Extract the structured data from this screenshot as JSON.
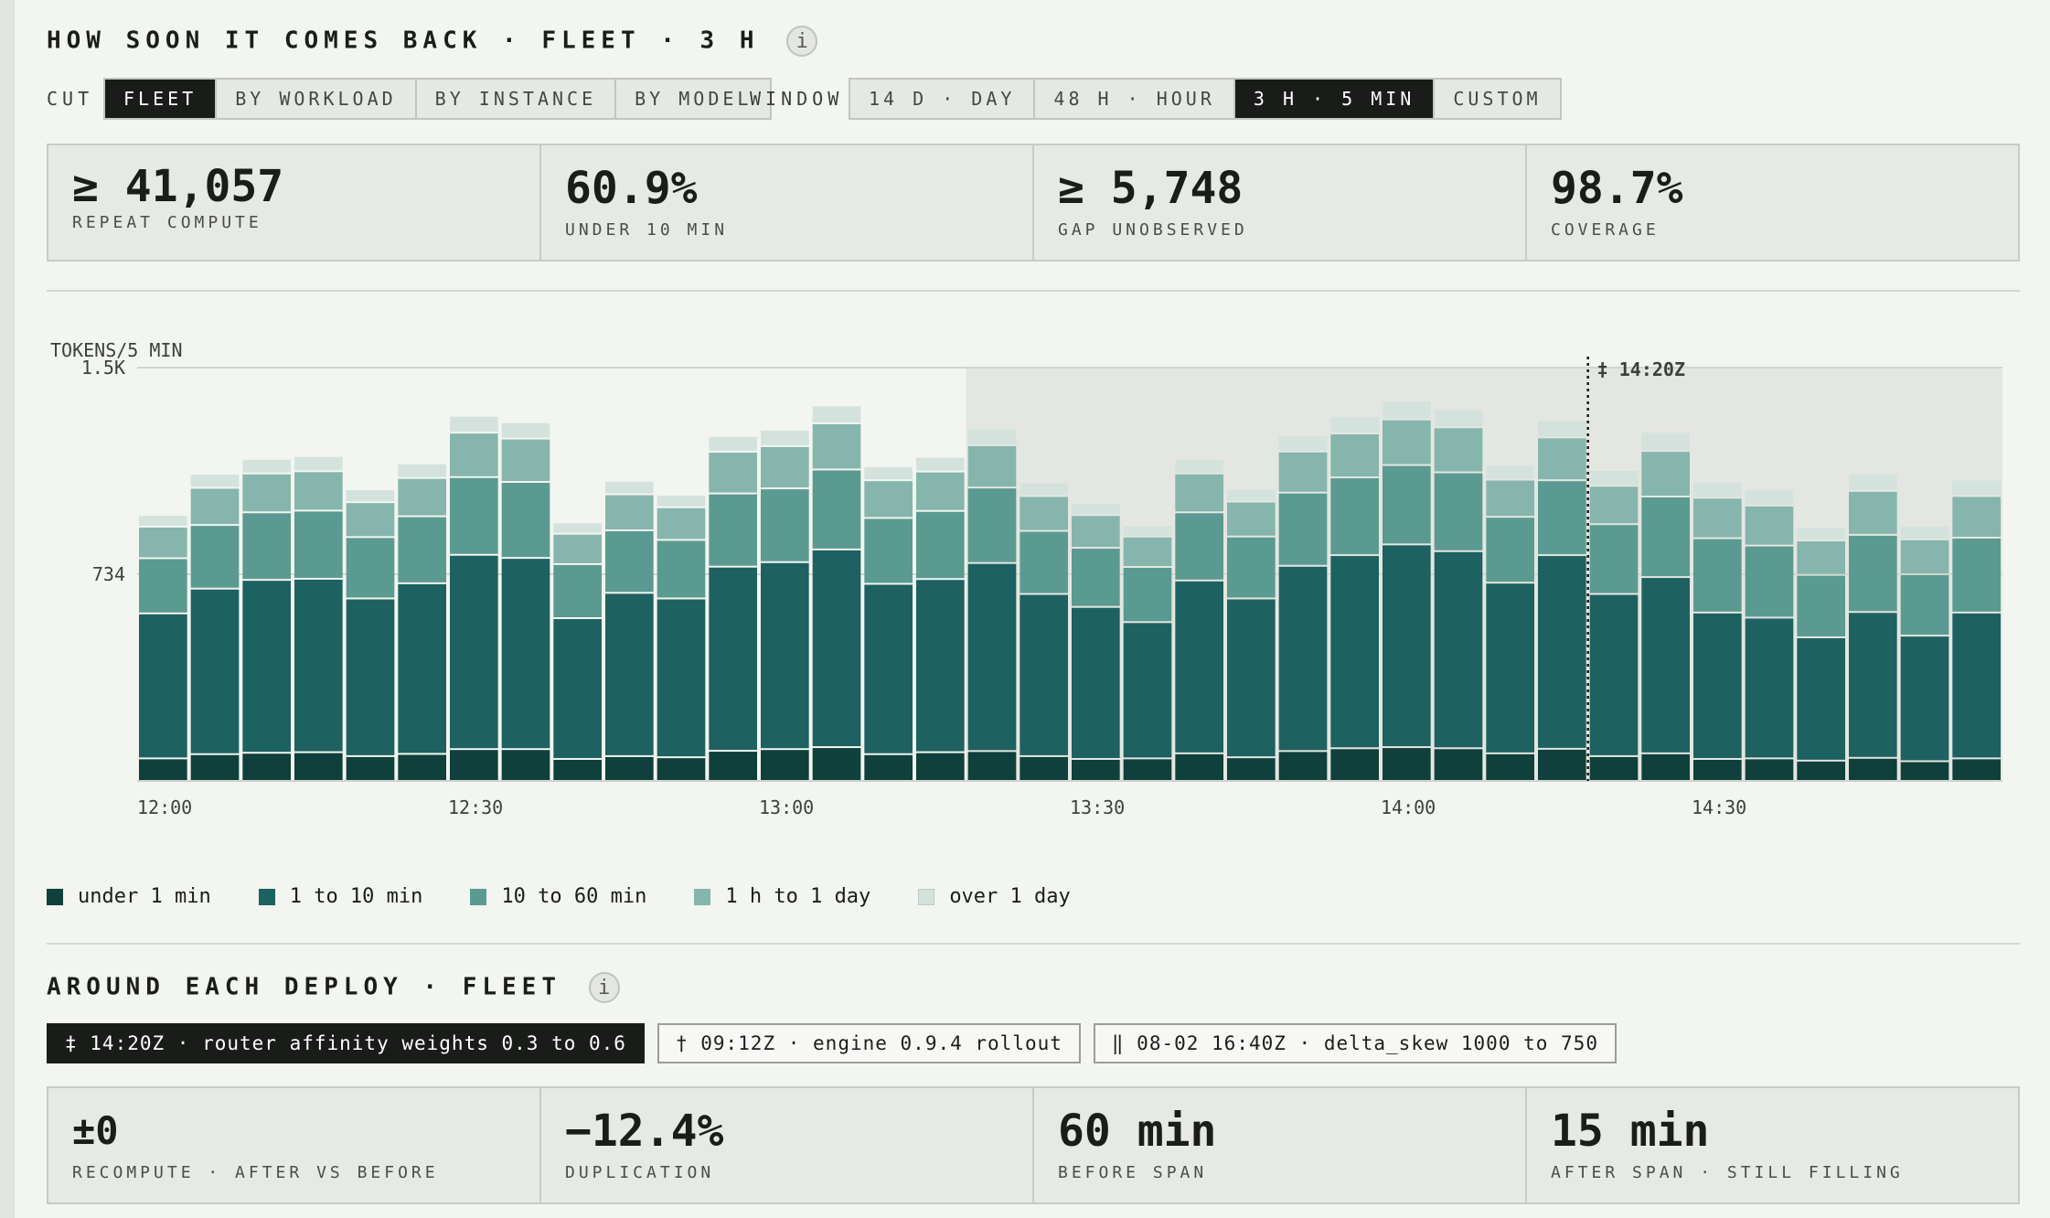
{
  "header": {
    "title": "HOW SOON IT COMES BACK · FLEET · 3 H",
    "info_icon": "i"
  },
  "controls": {
    "cut_label": "CUT",
    "cut_options": [
      "FLEET",
      "BY WORKLOAD",
      "BY INSTANCE",
      "BY MODEL"
    ],
    "cut_selected": "FLEET",
    "window_label": "WINDOW",
    "window_options": [
      "14 D · DAY",
      "48 H · HOUR",
      "3 H · 5 MIN",
      "CUSTOM"
    ],
    "window_selected": "3 H · 5 MIN"
  },
  "stats": [
    {
      "value": "≥ 41,057",
      "label": "REPEAT COMPUTE"
    },
    {
      "value": "60.9%",
      "label": "UNDER 10 MIN"
    },
    {
      "value": "≥ 5,748",
      "label": "GAP UNOBSERVED"
    },
    {
      "value": "98.7%",
      "label": "COVERAGE"
    }
  ],
  "chart_data": {
    "type": "bar",
    "stacked": true,
    "ylabel": "TOKENS/5 MIN",
    "ylim": [
      0,
      1468
    ],
    "yticks": [
      {
        "value": 734,
        "label": "734"
      },
      {
        "value": 1468,
        "label": "1.5K"
      }
    ],
    "xticks": [
      {
        "index": 0,
        "label": "12:00"
      },
      {
        "index": 6,
        "label": "12:30"
      },
      {
        "index": 12,
        "label": "13:00"
      },
      {
        "index": 18,
        "label": "13:30"
      },
      {
        "index": 24,
        "label": "14:00"
      },
      {
        "index": 30,
        "label": "14:30"
      }
    ],
    "x": [
      "12:00",
      "12:05",
      "12:10",
      "12:15",
      "12:20",
      "12:25",
      "12:30",
      "12:35",
      "12:40",
      "12:45",
      "12:50",
      "12:55",
      "13:00",
      "13:05",
      "13:10",
      "13:15",
      "13:20",
      "13:25",
      "13:30",
      "13:35",
      "13:40",
      "13:45",
      "13:50",
      "13:55",
      "14:00",
      "14:05",
      "14:10",
      "14:15",
      "14:20",
      "14:25",
      "14:30",
      "14:35",
      "14:40",
      "14:45",
      "14:50",
      "14:55"
    ],
    "series": [
      {
        "name": "under 1 min",
        "color": "#0f403b",
        "values": [
          80,
          95,
          100,
          102,
          88,
          96,
          113,
          113,
          78,
          88,
          84,
          107,
          113,
          120,
          95,
          102,
          106,
          88,
          78,
          80,
          98,
          84,
          106,
          116,
          120,
          116,
          98,
          114,
          88,
          98,
          78,
          80,
          72,
          82,
          70,
          80
        ]
      },
      {
        "name": "1 to 10 min",
        "color": "#1d6160",
        "values": [
          515,
          588,
          614,
          616,
          560,
          606,
          690,
          679,
          500,
          580,
          564,
          654,
          664,
          702,
          605,
          615,
          668,
          576,
          540,
          484,
          614,
          564,
          658,
          686,
          720,
          700,
          606,
          688,
          576,
          626,
          520,
          500,
          438,
          518,
          446,
          518
        ]
      },
      {
        "name": "10 to 60 min",
        "color": "#5a9a91",
        "values": [
          196,
          226,
          240,
          242,
          218,
          238,
          276,
          270,
          192,
          222,
          208,
          260,
          262,
          284,
          234,
          242,
          268,
          224,
          210,
          196,
          242,
          220,
          260,
          276,
          282,
          280,
          234,
          266,
          248,
          286,
          264,
          256,
          222,
          274,
          218,
          266
        ]
      },
      {
        "name": "1 h to 1 day",
        "color": "#86b5ad",
        "values": [
          112,
          132,
          138,
          140,
          124,
          136,
          158,
          154,
          108,
          128,
          116,
          148,
          150,
          164,
          134,
          140,
          150,
          124,
          116,
          108,
          138,
          124,
          146,
          156,
          162,
          160,
          132,
          152,
          136,
          162,
          144,
          142,
          122,
          156,
          124,
          148
        ]
      },
      {
        "name": "over 1 day",
        "color": "#d3e2dc",
        "values": [
          42,
          50,
          52,
          54,
          46,
          52,
          60,
          58,
          40,
          48,
          44,
          56,
          58,
          64,
          50,
          52,
          60,
          48,
          44,
          40,
          52,
          46,
          56,
          62,
          66,
          64,
          52,
          62,
          56,
          68,
          56,
          58,
          48,
          62,
          48,
          58
        ]
      }
    ],
    "shaded_range": [
      16,
      35
    ],
    "marker": {
      "index": 28,
      "label": "‡ 14:20Z"
    },
    "grid": true
  },
  "legend": [
    {
      "label": "under 1 min",
      "color": "#0f403b"
    },
    {
      "label": "1 to 10 min",
      "color": "#1d6160"
    },
    {
      "label": "10 to 60 min",
      "color": "#5a9a91"
    },
    {
      "label": "1 h to 1 day",
      "color": "#86b5ad"
    },
    {
      "label": "over 1 day",
      "color": "#d3e2dc"
    }
  ],
  "deploys": {
    "title": "AROUND EACH DEPLOY · FLEET",
    "info_icon": "i",
    "chips": [
      {
        "label": "‡ 14:20Z · router affinity weights 0.3 to 0.6",
        "active": true
      },
      {
        "label": "† 09:12Z · engine 0.9.4 rollout",
        "active": false
      },
      {
        "label": "‖ 08-02 16:40Z · delta_skew 1000 to 750",
        "active": false
      }
    ],
    "stats": [
      {
        "value": "±0",
        "label": "RECOMPUTE · AFTER VS BEFORE"
      },
      {
        "value": "−12.4%",
        "label": "DUPLICATION"
      },
      {
        "value": "60 min",
        "label": "BEFORE SPAN"
      },
      {
        "value": "15 min",
        "label": "AFTER SPAN · STILL FILLING"
      }
    ]
  }
}
